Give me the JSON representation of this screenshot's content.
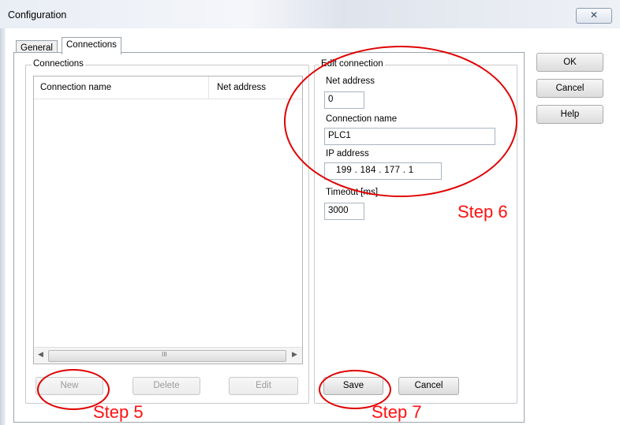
{
  "window": {
    "title": "Configuration",
    "close_glyph": "✕"
  },
  "tabs": [
    {
      "label": "General",
      "active": false
    },
    {
      "label": "Connections",
      "active": true
    }
  ],
  "connections_group": {
    "title": "Connections",
    "columns": [
      "Connection name",
      "Net address"
    ],
    "rows": [],
    "scroll_mark": "III",
    "buttons": {
      "new": {
        "label": "New",
        "enabled": false
      },
      "delete": {
        "label": "Delete",
        "enabled": false
      },
      "edit": {
        "label": "Edit",
        "enabled": false
      }
    }
  },
  "edit_group": {
    "title": "Edit connection",
    "net_address": {
      "label": "Net address",
      "value": "0"
    },
    "connection_name": {
      "label": "Connection name",
      "value": "PLC1"
    },
    "ip_address": {
      "label": "IP address",
      "octets": [
        "199",
        "184",
        "177",
        "1"
      ]
    },
    "timeout": {
      "label": "Timeout [ms]",
      "value": "3000"
    },
    "save_label": "Save",
    "cancel_label": "Cancel"
  },
  "dialog_buttons": {
    "ok": "OK",
    "cancel": "Cancel",
    "help": "Help"
  },
  "annotations": {
    "step5": "Step 5",
    "step6": "Step 6",
    "step7": "Step 7",
    "color": "#ff1010"
  }
}
